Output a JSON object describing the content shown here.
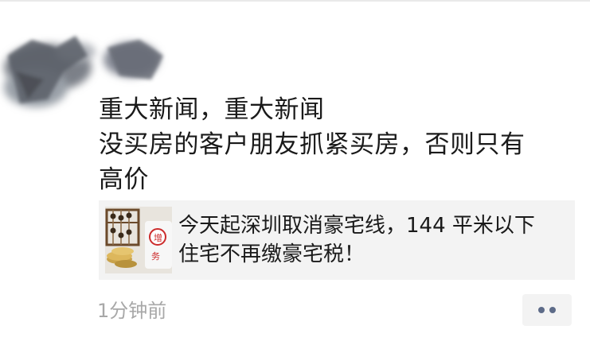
{
  "post": {
    "lines": [
      "重大新闻，重大新闻",
      "没买房的客户朋友抓紧买房，否则只有",
      "高价"
    ]
  },
  "link_card": {
    "thumbnail_icon": "abacus-coins-tax-icon",
    "thumbnail_text": "增 务",
    "title_lines": [
      "今天起深圳取消豪宅线，144 平米以下",
      "住宅不再缴豪宅税！"
    ]
  },
  "footer": {
    "timestamp": "1分钟前",
    "more_icon": "ellipsis-icon"
  },
  "colors": {
    "text": "#1a1a1a",
    "card_bg": "#f3f3f3",
    "timestamp": "#a8a8a8",
    "dot": "#5d6b88"
  }
}
